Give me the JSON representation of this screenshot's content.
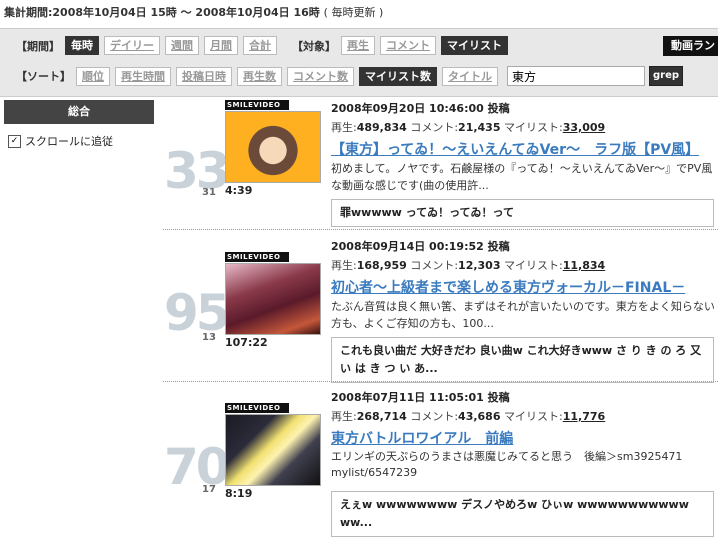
{
  "period": {
    "label": "集計期間:",
    "range": "2008年10月04日 15時 ～ 2008年10月04日 16時",
    "note": "( 毎時更新 )"
  },
  "filters": {
    "period_label": "【期間】",
    "period_options": [
      "毎時",
      "デイリー",
      "週間",
      "月間",
      "合計"
    ],
    "period_selected": "毎時",
    "target_label": "【対象】",
    "target_options": [
      "再生",
      "コメント",
      "マイリスト"
    ],
    "target_selected": "マイリスト",
    "sort_label": "【ソート】",
    "sort_options": [
      "順位",
      "再生時間",
      "投稿日時",
      "再生数",
      "コメント数",
      "マイリスト数",
      "タイトル"
    ],
    "sort_selected": "マイリスト数",
    "search_value": "東方",
    "grep_label": "grep",
    "ranking_button": "動画ランキング"
  },
  "sidebar": {
    "heading": "総合",
    "follow_scroll": "スクロールに追従",
    "follow_checked": true
  },
  "badge_text": "SMILEVIDEO",
  "entries": [
    {
      "rank": "33",
      "prev_rank": "31",
      "length": "4:39",
      "date": "2008年09月20日 10:46:00 投稿",
      "plays_label": "再生:",
      "plays": "489,834",
      "comments_label": "コメント:",
      "comments": "21,435",
      "mylist_label": "マイリスト:",
      "mylist": "33,009",
      "title": "【東方】ってゐ！～えいえんてゐVer～　ラフ版【PV風】",
      "desc": "初めまして。ノヤです。石鹸屋様の『ってゐ！～えいえんてゐVer～』でPV風な動画な感じです(曲の使用許...",
      "comment": "罪wwwww ってゐ！ってゐ！って"
    },
    {
      "rank": "95",
      "prev_rank": "13",
      "length": "107:22",
      "date": "2008年09月14日 00:19:52 投稿",
      "plays_label": "再生:",
      "plays": "168,959",
      "comments_label": "コメント:",
      "comments": "12,303",
      "mylist_label": "マイリスト:",
      "mylist": "11,834",
      "title": "初心者～上級者まで楽しめる東方ヴォーカル－FINAL－",
      "desc": "たぶん音質は良く無い筈、まずはそれが言いたいのです。東方をよく知らない方も、よくご存知の方も、100...",
      "comment": "これも良い曲だ 大好きだわ 良い曲w これ大好きwww さ り き の ろ 又 い は き つ い あ..."
    },
    {
      "rank": "70",
      "prev_rank": "17",
      "length": "8:19",
      "date": "2008年07月11日 11:05:01 投稿",
      "plays_label": "再生:",
      "plays": "268,714",
      "comments_label": "コメント:",
      "comments": "43,686",
      "mylist_label": "マイリスト:",
      "mylist": "11,776",
      "title": "東方バトルロワイアル　前編",
      "desc": "エリンギの天ぷらのうまさは悪魔じみてると思う　後編＞sm3925471",
      "desc2": "mylist/6547239",
      "comment": "えぇw wwwwwwww デスノやめろw ひぃw wwwwwwwwwww ww..."
    }
  ],
  "colors": {
    "title_link": "#3a7bbf",
    "rank_number": "#c8d2d8",
    "active_button": "#333333"
  }
}
